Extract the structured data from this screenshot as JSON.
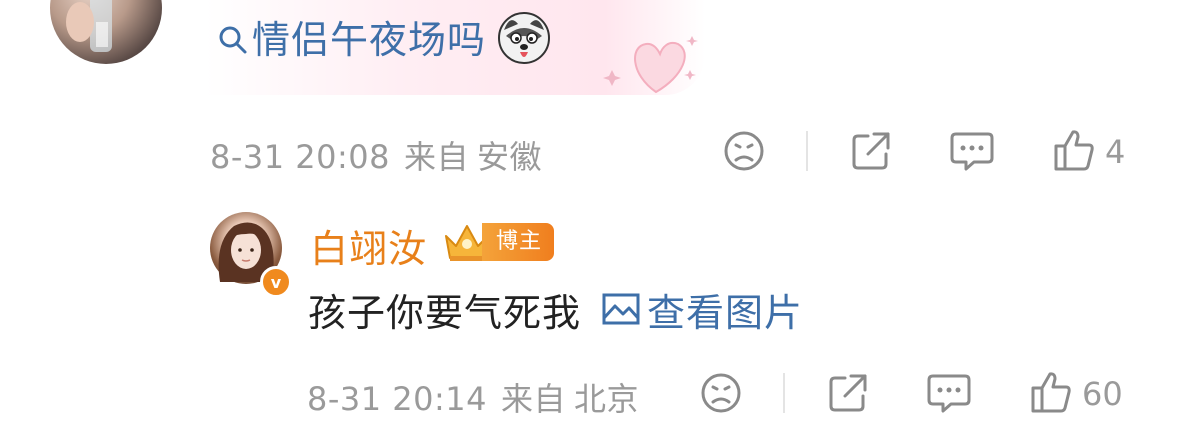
{
  "comment1": {
    "search_text": "情侣午夜场吗",
    "meta": {
      "time": "8-31 20:08",
      "from_prefix": "来自",
      "location": "安徽"
    },
    "actions": {
      "like_count": "4"
    }
  },
  "reply": {
    "username": "白翊汝",
    "badge_label": "博主",
    "text": "孩子你要气死我",
    "image_link_label": "查看图片",
    "meta": {
      "time": "8-31 20:14",
      "from_prefix": "来自",
      "location": "北京"
    },
    "actions": {
      "like_count": "60"
    }
  },
  "colors": {
    "link": "#3e6fa8",
    "username": "#e8801a",
    "meta": "#9a9a9a",
    "badge": "#f07e1e"
  },
  "icons": [
    "search-icon",
    "husky-emoji-icon",
    "heart-sticker-icon",
    "emoji-face-icon",
    "share-icon",
    "comment-icon",
    "like-icon",
    "crown-icon",
    "verified-v-icon",
    "image-icon"
  ]
}
